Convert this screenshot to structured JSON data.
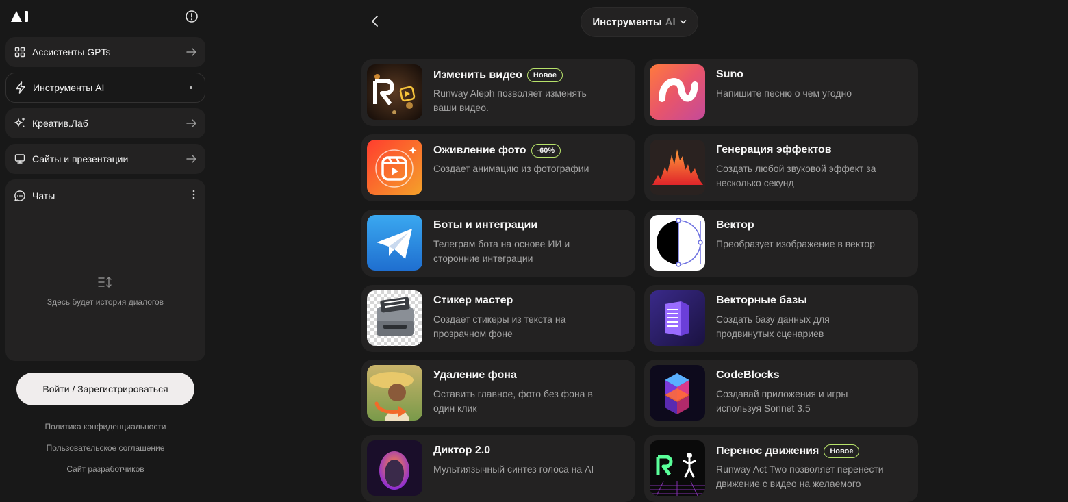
{
  "sidebar": {
    "nav": [
      {
        "label": "Ассистенты GPTs",
        "icon": "grid-icon"
      },
      {
        "label": "Инструменты AI",
        "icon": "lightning-icon"
      },
      {
        "label": "Креатив.Лаб",
        "icon": "sparkle-icon"
      },
      {
        "label": "Сайты и презентации",
        "icon": "monitor-icon"
      }
    ],
    "chats": {
      "title": "Чаты",
      "empty_text": "Здесь будет история диалогов"
    },
    "login_label": "Войти / Зарегистрироваться",
    "footer_links": [
      "Политика конфиденциальности",
      "Пользовательское соглашение",
      "Сайт разработчиков"
    ]
  },
  "header": {
    "title": "Инструменты",
    "title_accent": "AI"
  },
  "tools": [
    {
      "title": "Изменить видео",
      "badge": "Новое",
      "desc": "Runway Aleph позволяет изменять ваши видео."
    },
    {
      "title": "Suno",
      "desc": "Напишите песню о чем угодно"
    },
    {
      "title": "Оживление фото",
      "badge": "-60%",
      "desc": "Создает анимацию из фотографии"
    },
    {
      "title": "Генерация эффектов",
      "desc": "Создать любой звуковой эффект за несколько секунд"
    },
    {
      "title": "Боты и интеграции",
      "desc": "Телеграм бота на основе ИИ и сторонние интеграции"
    },
    {
      "title": "Вектор",
      "desc": "Преобразует изображение в вектор"
    },
    {
      "title": "Стикер мастер",
      "desc": "Создает стикеры из текста на прозрачном фоне"
    },
    {
      "title": "Векторные базы",
      "desc": "Создать базу данных для продвинутых сценариев"
    },
    {
      "title": "Удаление фона",
      "desc": "Оставить главное, фото без фона в один клик"
    },
    {
      "title": "CodeBlocks",
      "desc": "Создавай приложения и игры используя Sonnet 3.5"
    },
    {
      "title": "Диктор 2.0",
      "desc": "Мультиязычный синтез голоса на AI"
    },
    {
      "title": "Перенос движения",
      "badge": "Новое",
      "desc": "Runway Act Two позволяет перенести движение с видео на желаемого"
    }
  ],
  "colors": {
    "background": "#181818",
    "card": "#232222",
    "badge_border": "#b7e26a",
    "muted_text": "#a4a4a4"
  }
}
